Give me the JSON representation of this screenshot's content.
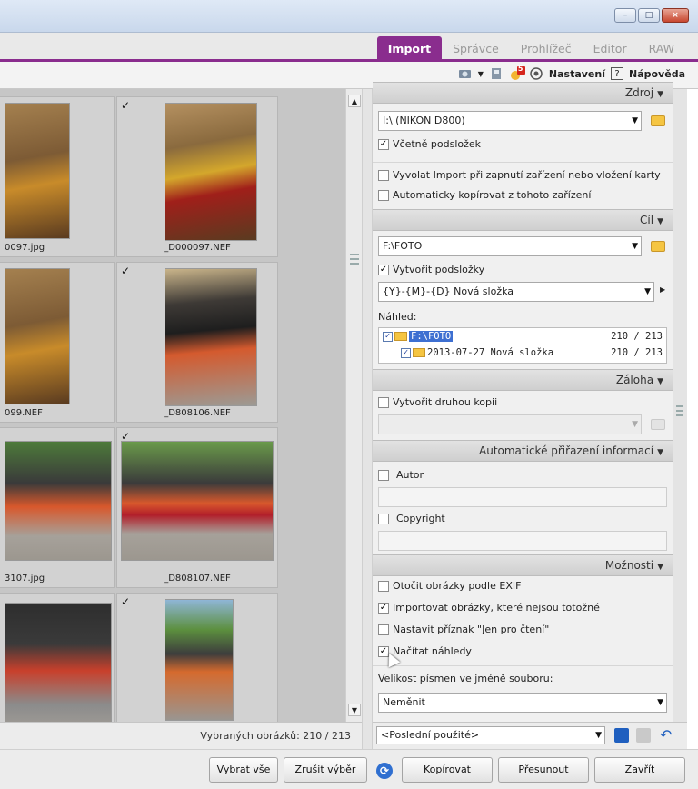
{
  "window": {
    "min": "–",
    "max": "□",
    "close": "×"
  },
  "tabs": [
    "Import",
    "Správce",
    "Prohlížeč",
    "Editor",
    "RAW"
  ],
  "toolbar": {
    "badge": "5",
    "settings_label": "Nastavení",
    "help_mark": "?",
    "help_label": "Nápověda"
  },
  "thumbs": [
    {
      "check": "",
      "label": "0097.jpg"
    },
    {
      "check": "✓",
      "label": "_D000097.NEF"
    },
    {
      "check": "",
      "label": "099.NEF"
    },
    {
      "check": "✓",
      "label": "_D808106.NEF"
    },
    {
      "check": "",
      "label": "3107.jpg"
    },
    {
      "check": "✓",
      "label": "_D808107.NEF"
    },
    {
      "check": "",
      "label": ""
    },
    {
      "check": "✓",
      "label": ""
    }
  ],
  "status": {
    "selected": "Vybraných obrázků: 210 / 213"
  },
  "panel": {
    "source_header": "Zdroj",
    "source_value": "I:\\ (NIKON D800)",
    "include_subfolders": "Včetně podsložek",
    "auto_import": "Vyvolat Import při zapnutí zařízení nebo vložení karty",
    "auto_copy": "Automaticky kopírovat z tohoto zařízení",
    "target_header": "Cíl",
    "target_value": "F:\\FOTO",
    "create_subfolders": "Vytvořit podsložky",
    "subfolder_pattern": "{Y}-{M}-{D} Nová složka",
    "preview_label": "Náhled:",
    "tree": [
      {
        "name": "F:\\FOTO",
        "count": "210 / 213"
      },
      {
        "name": "2013-07-27 Nová složka",
        "count": "210 / 213"
      }
    ],
    "backup_header": "Záloha",
    "second_copy": "Vytvořit druhou kopii",
    "autoinfo_header": "Automatické přiřazení informací",
    "author": "Autor",
    "copyright": "Copyright",
    "options_header": "Možnosti",
    "rotate_exif": "Otočit obrázky podle EXIF",
    "import_identical": "Importovat obrázky, které nejsou totožné",
    "read_only": "Nastavit příznak \"Jen pro čtení\"",
    "load_previews": "Načítat náhledy",
    "filename_case_label": "Velikost písmen ve jméně souboru:",
    "filename_case_value": "Neměnit"
  },
  "preset": "<Poslední použité>",
  "buttons": {
    "select_all": "Vybrat vše",
    "deselect": "Zrušit výběr",
    "copy": "Kopírovat",
    "move": "Přesunout",
    "close": "Zavřít"
  },
  "colors": {
    "accent": "#8a2d8e",
    "selection": "#3d6fd1"
  }
}
